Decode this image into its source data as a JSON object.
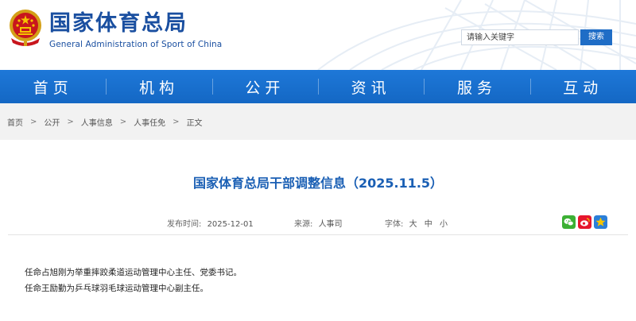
{
  "header": {
    "title_cn": "国家体育总局",
    "title_en": "General Administration of Sport of China",
    "emblem_icon": "national-emblem-icon"
  },
  "search": {
    "placeholder": "请输入关键字",
    "button_label": "搜索"
  },
  "nav": {
    "items": [
      {
        "label": "首页"
      },
      {
        "label": "机构"
      },
      {
        "label": "公开"
      },
      {
        "label": "资讯"
      },
      {
        "label": "服务"
      },
      {
        "label": "互动"
      }
    ]
  },
  "breadcrumb": {
    "items": [
      "首页",
      "公开",
      "人事信息",
      "人事任免",
      "正文"
    ],
    "separator": ">"
  },
  "article": {
    "title": "国家体育总局干部调整信息（2025.11.5）",
    "publish_label": "发布时间:",
    "publish_date": "2025-12-01",
    "source_label": "来源:",
    "source_value": "人事司",
    "font_label": "字体:",
    "font_large": "大",
    "font_medium": "中",
    "font_small": "小",
    "paragraphs": [
      "任命占旭刚为举重摔跤柔道运动管理中心主任、党委书记。",
      "任命王励勤为乒乓球羽毛球运动管理中心副主任。"
    ]
  },
  "share": {
    "wechat_icon": "wechat-icon",
    "weibo_icon": "weibo-icon",
    "qzone_icon": "qzone-icon",
    "colors": {
      "wechat": "#3cb034",
      "weibo": "#e6162d",
      "qzone": "#2b7fd8"
    }
  },
  "theme": {
    "nav_color": "#1a6fd0",
    "title_color": "#1a4fa0",
    "article_title_color": "#1a5fb4"
  }
}
